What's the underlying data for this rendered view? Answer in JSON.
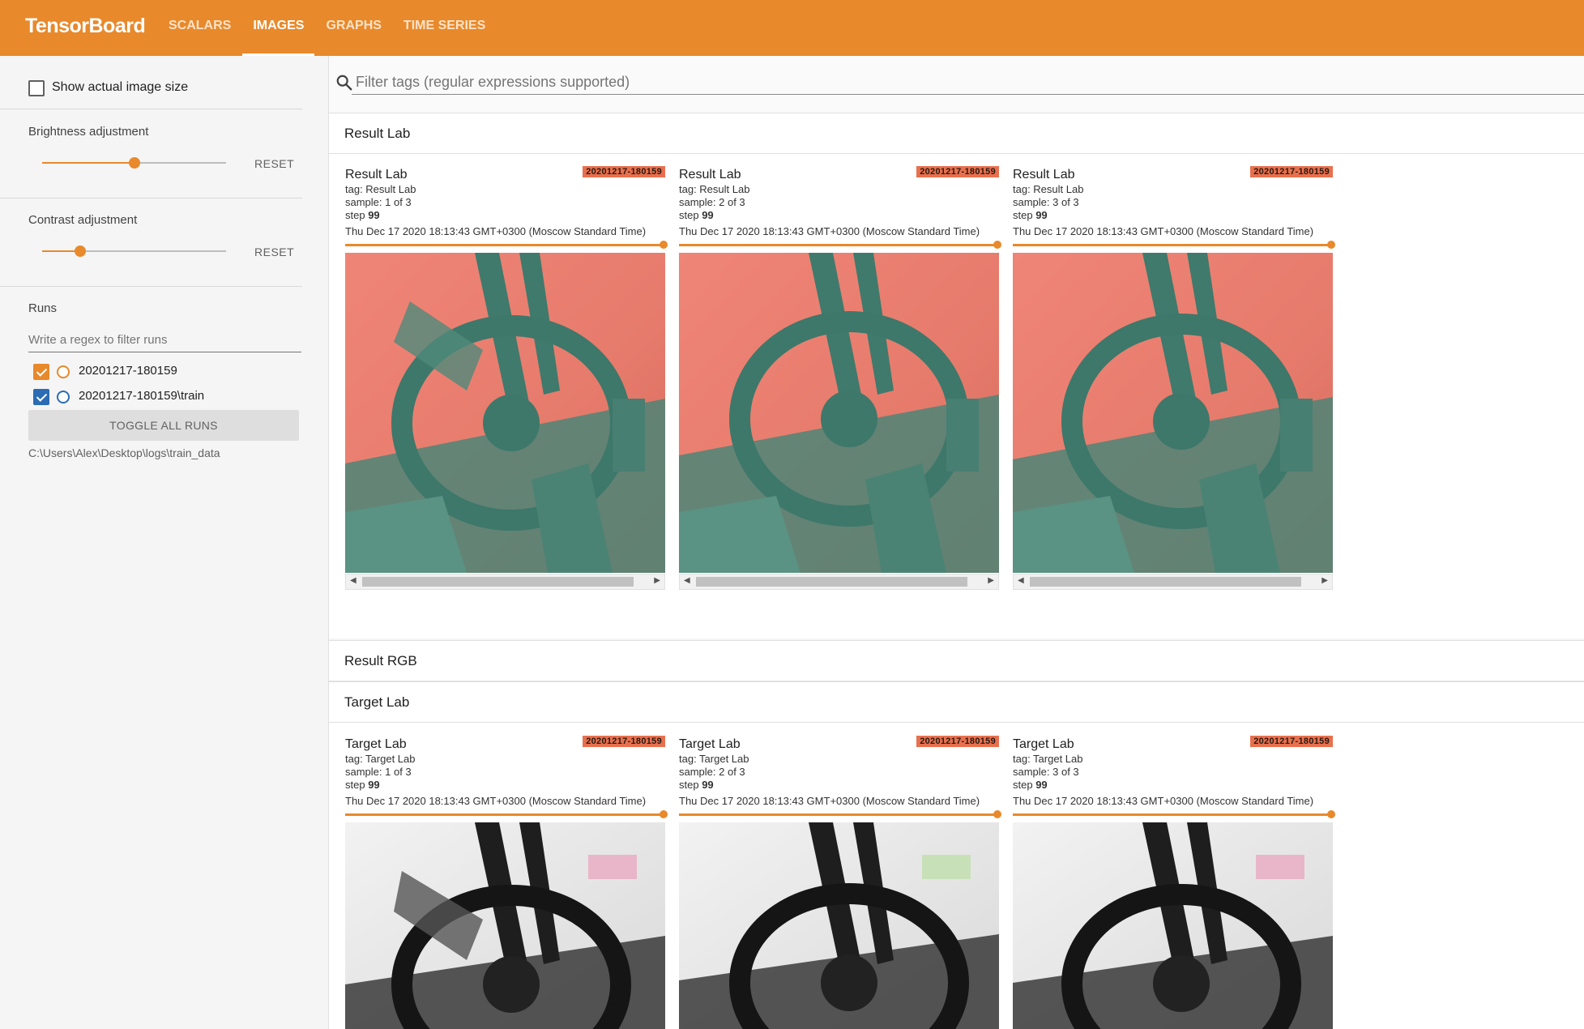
{
  "app": {
    "brand": "TensorBoard"
  },
  "colors": {
    "accent": "#e8892b",
    "run1": "#e8892b",
    "run2": "#2b6cb4",
    "badge": "#e8704e"
  },
  "nav": {
    "tabs": [
      {
        "label": "SCALARS",
        "active": false
      },
      {
        "label": "IMAGES",
        "active": true
      },
      {
        "label": "GRAPHS",
        "active": false
      },
      {
        "label": "TIME SERIES",
        "active": false
      }
    ]
  },
  "sidebar": {
    "show_actual_size": {
      "label": "Show actual image size",
      "checked": false
    },
    "brightness": {
      "label": "Brightness adjustment",
      "reset": "RESET",
      "value": 0.5
    },
    "contrast": {
      "label": "Contrast adjustment",
      "reset": "RESET",
      "value": 0.2
    },
    "runs": {
      "title": "Runs",
      "filter_placeholder": "Write a regex to filter runs",
      "items": [
        {
          "name": "20201217-180159",
          "checked": true,
          "color": "#e8892b"
        },
        {
          "name": "20201217-180159\\train",
          "checked": true,
          "color": "#2b6cb4"
        }
      ],
      "toggle_all": "TOGGLE ALL RUNS",
      "logdir": "C:\\Users\\Alex\\Desktop\\logs\\train_data"
    }
  },
  "main": {
    "search_placeholder": "Filter tags (regular expressions supported)",
    "sections": [
      {
        "title": "Result Lab",
        "cards": [
          {
            "title": "Result Lab",
            "run": "20201217-180159",
            "tag": "tag: Result Lab",
            "sample": "sample: 1 of 3",
            "step_label": "step",
            "step": "99",
            "time": "Thu Dec 17 2020 18:13:43 GMT+0300 (Moscow Standard Time)"
          },
          {
            "title": "Result Lab",
            "run": "20201217-180159",
            "tag": "tag: Result Lab",
            "sample": "sample: 2 of 3",
            "step_label": "step",
            "step": "99",
            "time": "Thu Dec 17 2020 18:13:43 GMT+0300 (Moscow Standard Time)"
          },
          {
            "title": "Result Lab",
            "run": "20201217-180159",
            "tag": "tag: Result Lab",
            "sample": "sample: 3 of 3",
            "step_label": "step",
            "step": "99",
            "time": "Thu Dec 17 2020 18:13:43 GMT+0300 (Moscow Standard Time)"
          }
        ]
      },
      {
        "title": "Result RGB",
        "cards": []
      },
      {
        "title": "Target Lab",
        "cards": [
          {
            "title": "Target Lab",
            "run": "20201217-180159",
            "tag": "tag: Target Lab",
            "sample": "sample: 1 of 3",
            "step_label": "step",
            "step": "99",
            "time": "Thu Dec 17 2020 18:13:43 GMT+0300 (Moscow Standard Time)"
          },
          {
            "title": "Target Lab",
            "run": "20201217-180159",
            "tag": "tag: Target Lab",
            "sample": "sample: 2 of 3",
            "step_label": "step",
            "step": "99",
            "time": "Thu Dec 17 2020 18:13:43 GMT+0300 (Moscow Standard Time)"
          },
          {
            "title": "Target Lab",
            "run": "20201217-180159",
            "tag": "tag: Target Lab",
            "sample": "sample: 3 of 3",
            "step_label": "step",
            "step": "99",
            "time": "Thu Dec 17 2020 18:13:43 GMT+0300 (Moscow Standard Time)"
          }
        ]
      }
    ]
  }
}
